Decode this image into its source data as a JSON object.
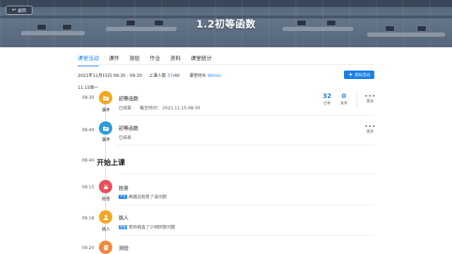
{
  "header": {
    "back_label": "返回",
    "title": "1.2初等函数"
  },
  "tabs": [
    {
      "label": "课堂活动",
      "active": true
    },
    {
      "label": "课件",
      "active": false
    },
    {
      "label": "测验",
      "active": false
    },
    {
      "label": "作业",
      "active": false
    },
    {
      "label": "资料",
      "active": false
    },
    {
      "label": "课堂统计",
      "active": false
    }
  ],
  "lesson_meta": {
    "datetime": "2021年11月15日 08:30 - 09:30",
    "attendance_label": "上课人数",
    "attendance_value": "37",
    "attendance_total": "/40",
    "duration_label": "课堂时长",
    "duration_value": "60min"
  },
  "add_button_label": "添加活动",
  "date_label": "11.15周一",
  "activities": [
    {
      "time": "08:30",
      "icon": "folder-icon",
      "icon_label": "课件",
      "title": "初等函数",
      "status": "已结束",
      "deadline_label": "截至时间：",
      "deadline": "2021.11.15.08:30",
      "learned_value": "32",
      "learned_label": "已学",
      "unlearned_value": "0",
      "unlearned_label": "未学",
      "more_label": "更多"
    },
    {
      "time": "08:40",
      "icon": "folder-icon",
      "icon_label": "课件",
      "title": "初等函数",
      "status": "已结束",
      "more_label": "更多"
    },
    {
      "time": "08:40",
      "title": "开始上课"
    },
    {
      "time": "09:15",
      "icon": "buzzer-icon",
      "icon_label": "抢答",
      "title": "抢答",
      "tag": "学生",
      "detail": "高璐远抢答了该问题"
    },
    {
      "time": "09:18",
      "icon": "person-icon",
      "icon_label": "挑人",
      "title": "挑人",
      "tag": "学生",
      "detail": "老师挑选了小明回答问题"
    },
    {
      "time": "09:20",
      "icon": "quiz-icon",
      "title": "测验"
    }
  ],
  "colors": {
    "accent": "#1a80e6",
    "folder_orange": "#f5a623",
    "folder_blue": "#2d9cdb",
    "buzzer_red": "#e8505b",
    "person_orange": "#f5a623",
    "quiz_orange": "#f08a3c"
  }
}
